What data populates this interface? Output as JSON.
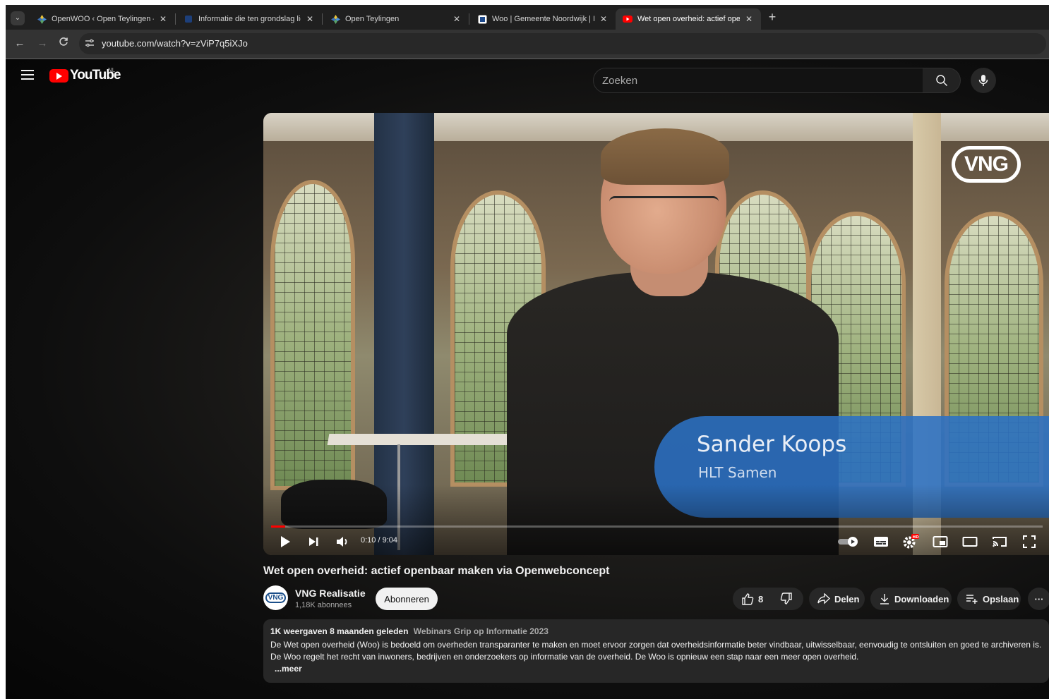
{
  "browser": {
    "tabs": [
      {
        "title": "OpenWOO ‹ Open Teylingen —",
        "favicon": "openwoo-diamond-icon",
        "active": false
      },
      {
        "title": "Informatie die ten grondslag lig",
        "favicon": "blue-doc-icon",
        "active": false
      },
      {
        "title": "Open Teylingen",
        "favicon": "openwoo-diamond-icon",
        "active": false
      },
      {
        "title": "Woo | Gemeente Noordwijk | H",
        "favicon": "noordwijk-icon",
        "active": false
      },
      {
        "title": "Wet open overheid: actief open",
        "favicon": "youtube-icon",
        "active": true
      }
    ],
    "url": "youtube.com/watch?v=zViP7q5iXJo"
  },
  "youtube": {
    "logo_text": "YouTube",
    "country": "NL",
    "search_placeholder": "Zoeken"
  },
  "video": {
    "overlay_name": "Sander Koops",
    "overlay_org": "HLT Samen",
    "watermark": "VNG",
    "time": "0:10 / 9:04",
    "progress": 0.0184,
    "title": "Wet open overheid: actief openbaar maken via Openwebconcept"
  },
  "channel": {
    "name": "VNG Realisatie",
    "subscribers": "1,18K abonnees",
    "avatar_text": "VNG",
    "subscribe_label": "Abonneren"
  },
  "actions": {
    "likes": "8",
    "share": "Delen",
    "download": "Downloaden",
    "save": "Opslaan"
  },
  "description": {
    "views": "1K weergaven",
    "date": "8 maanden geleden",
    "playlist": "Webinars Grip op Informatie 2023",
    "text": "De Wet open overheid (Woo) is bedoeld om overheden transparanter te maken en moet ervoor zorgen dat overheidsinformatie beter vindbaar, uitwisselbaar, eenvoudig te ontsluiten en goed te archiveren is. De Woo regelt het recht van inwoners, bedrijven en onderzoekers op informatie van de overheid. De Woo is opnieuw een stap naar een meer open overheid.",
    "more": "...meer"
  },
  "colors": {
    "accent_red": "#ff0000",
    "overlay_blue": "#2b71c4",
    "background": "#0f0f0f"
  }
}
